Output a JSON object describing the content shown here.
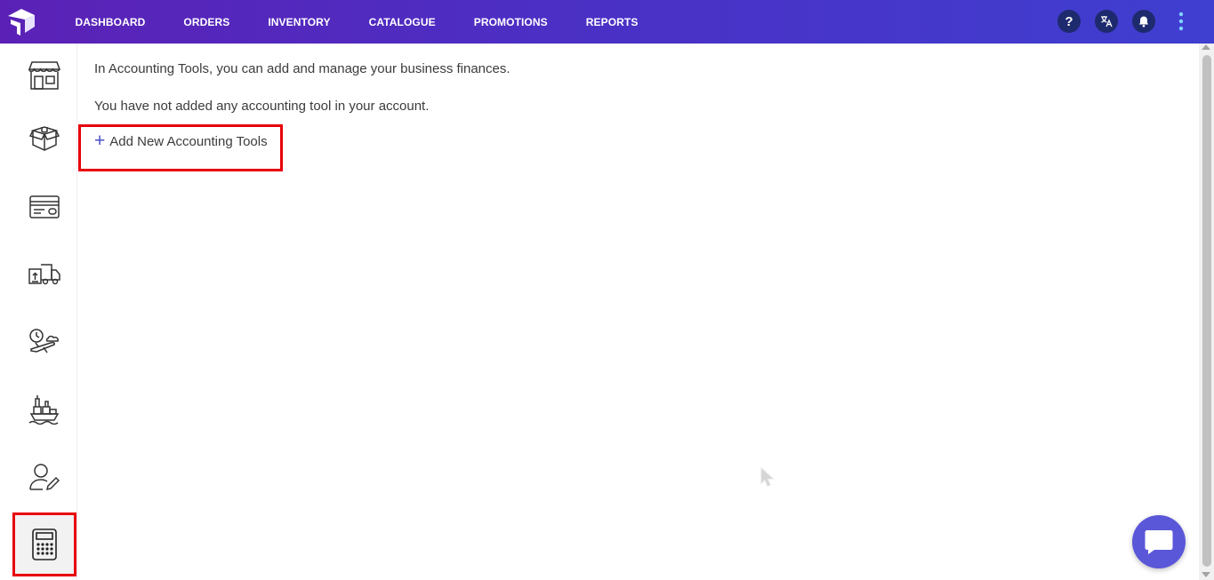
{
  "nav": {
    "items": [
      "DASHBOARD",
      "ORDERS",
      "INVENTORY",
      "CATALOGUE",
      "PROMOTIONS",
      "REPORTS"
    ],
    "icons": [
      "help-icon",
      "translate-icon",
      "bell-icon",
      "more-vertical-icon"
    ],
    "help_glyph": "?"
  },
  "sidebar": {
    "icons": [
      "store-icon",
      "open-box-icon",
      "payment-card-icon",
      "delivery-truck-icon",
      "flight-schedule-icon",
      "cargo-ship-icon",
      "user-edit-icon",
      "calculator-icon"
    ],
    "active_index": 7
  },
  "content": {
    "intro": "In Accounting Tools, you can add and manage your business finances.",
    "empty_message": "You have not added any accounting tool in your account.",
    "add_button_label": "Add New Accounting Tools",
    "add_button_icon": "plus-icon"
  },
  "colors": {
    "accent": "#4a4fc7",
    "highlight": "#e8000b",
    "topbar_start": "#5b21b6",
    "topbar_end": "#3f3fd0"
  }
}
